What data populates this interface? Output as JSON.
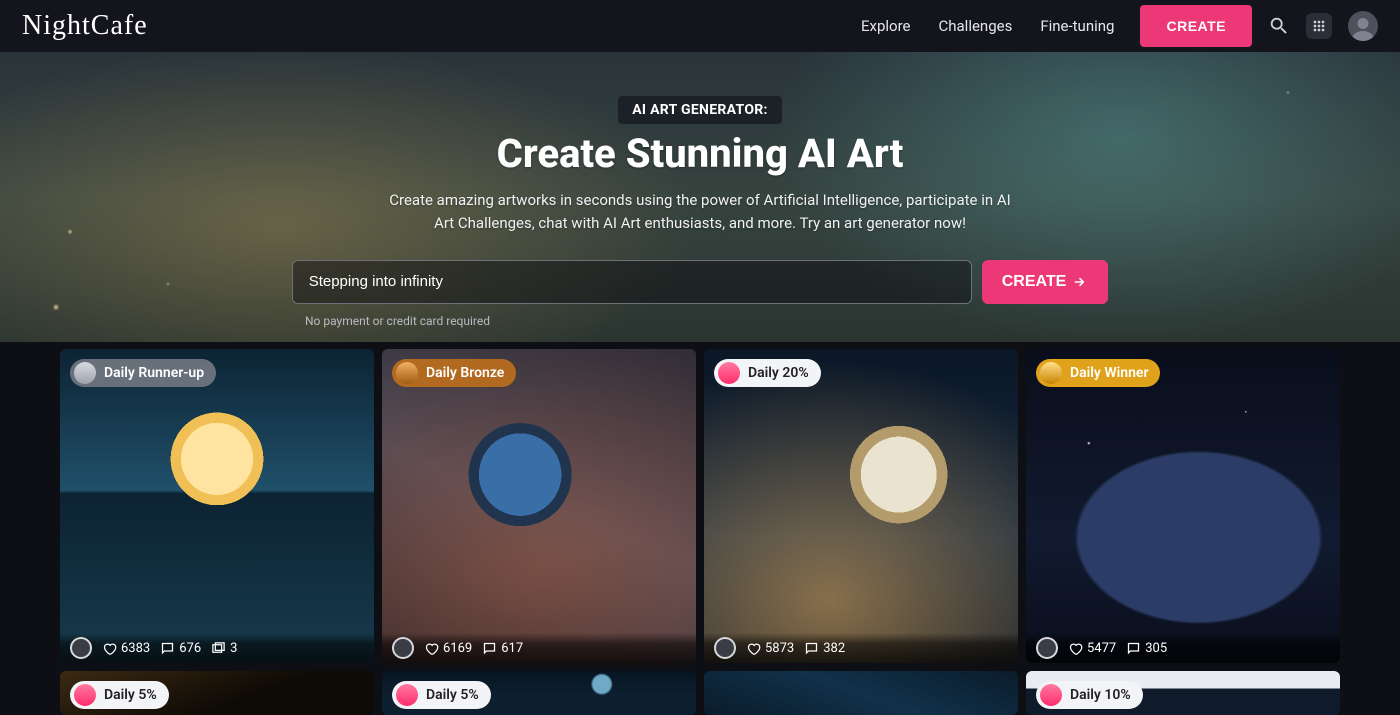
{
  "brand": "NightCafe",
  "nav": {
    "explore": "Explore",
    "challenges": "Challenges",
    "finetune": "Fine-tuning",
    "create": "CREATE"
  },
  "hero": {
    "tag": "AI ART GENERATOR:",
    "title": "Create Stunning AI Art",
    "subtitle": "Create amazing artworks in seconds using the power of Artificial Intelligence, participate in AI Art Challenges, chat with AI Art enthusiasts, and more. Try an art generator now!",
    "prompt_value": "Stepping into infinity",
    "create_label": "CREATE",
    "note": "No payment or credit card required"
  },
  "cards": [
    {
      "badge_class": "gray",
      "badge_label": "Daily Runner-up",
      "likes": "6383",
      "comments": "676",
      "images": "3"
    },
    {
      "badge_class": "bronze",
      "badge_label": "Daily Bronze",
      "likes": "6169",
      "comments": "617"
    },
    {
      "badge_class": "white",
      "badge_label": "Daily 20%",
      "likes": "5873",
      "comments": "382"
    },
    {
      "badge_class": "gold",
      "badge_label": "Daily Winner",
      "likes": "5477",
      "comments": "305"
    }
  ],
  "cards2": [
    {
      "badge_class": "white",
      "badge_label": "Daily 5%"
    },
    {
      "badge_class": "white",
      "badge_label": "Daily 5%"
    },
    {
      "badge_class": "",
      "badge_label": ""
    },
    {
      "badge_class": "white",
      "badge_label": "Daily 10%"
    }
  ]
}
